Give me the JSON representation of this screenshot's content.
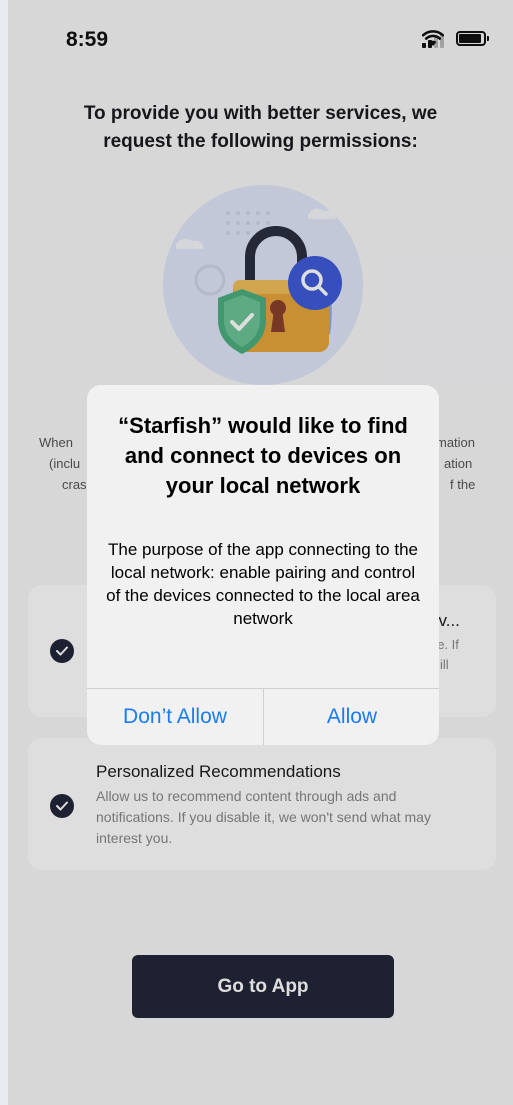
{
  "status_bar": {
    "time": "8:59",
    "signal_icon": "cellular-signal-icon",
    "wifi_icon": "wifi-icon",
    "battery_icon": "battery-icon"
  },
  "page": {
    "title": "To provide you with better services, we request the following permissions:",
    "hero_icon": "padlock-shield-search-illustration",
    "intro_lines": [
      "When",
      "mation",
      "(inclu",
      "ation",
      "cras",
      "f the"
    ]
  },
  "permissions": [
    {
      "title": "tiv...",
      "description_lines": [
        "ge. If",
        "ill"
      ],
      "checked": true
    },
    {
      "title": "Personalized Recommendations",
      "description": "Allow us to recommend content through ads and notifications. If you disable it, we won't send what may interest you.",
      "checked": true
    }
  ],
  "go_button": {
    "label": "Go to App"
  },
  "alert": {
    "title": "“Starfish” would like to find and connect to devices on your local network",
    "message": "The purpose of the app connecting to the local network: enable pairing and control of the devices connected to the local area network",
    "buttons": {
      "deny": "Don’t Allow",
      "allow": "Allow"
    },
    "button_color": "#1a7bf2"
  },
  "colors": {
    "primary_dark": "#23273a",
    "shield_green": "#4caf7f",
    "lock_orange": "#e6a63a",
    "search_blue": "#3f5bd8"
  }
}
